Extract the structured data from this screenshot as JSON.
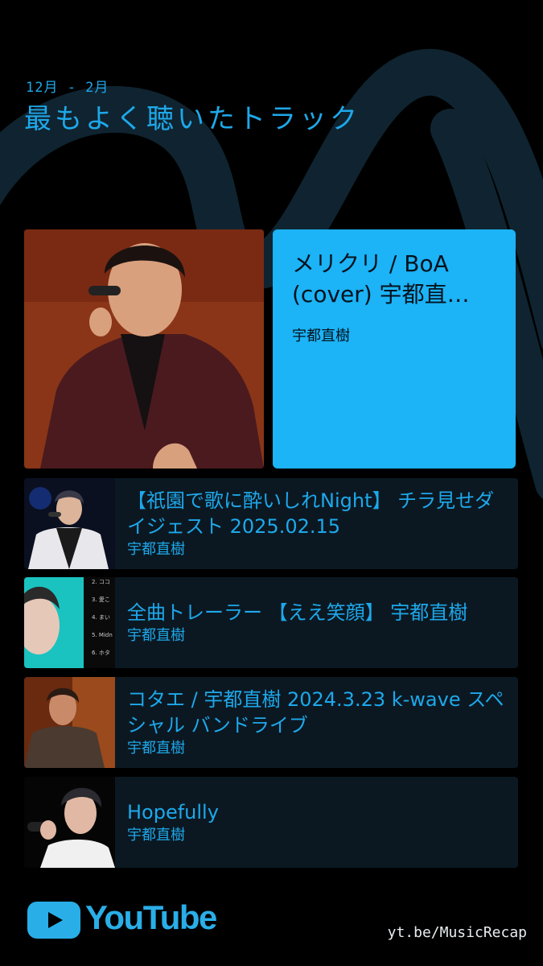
{
  "header": {
    "period": "12月 - 2月",
    "title": "最もよく聴いたトラック"
  },
  "top_track": {
    "title": "メリクリ / BoA (cover) 宇都直…",
    "artist": "宇都直樹"
  },
  "tracks": [
    {
      "title": "【祇園で歌に酔いしれNight】 チラ見せダイジェスト 2025.02.15",
      "artist": "宇都直樹"
    },
    {
      "title": "全曲トレーラー 【ええ笑顔】 宇都直樹",
      "artist": "宇都直樹"
    },
    {
      "title": "コタエ / 宇都直樹 2024.3.23 k-wave スペシャル バンドライブ",
      "artist": "宇都直樹"
    },
    {
      "title": "Hopefully",
      "artist": "宇都直樹"
    }
  ],
  "thumb2_list": [
    "2. ココ",
    "3. 愛こ",
    "4. まい",
    "5. Midn",
    "6. ホタ"
  ],
  "footer": {
    "brand": "YouTube",
    "link": "yt.be/MusicRecap"
  },
  "colors": {
    "accent": "#1ea8ea",
    "card_bg": "#1cb3f7",
    "row_bg": "#0b1822",
    "background": "#000000"
  }
}
